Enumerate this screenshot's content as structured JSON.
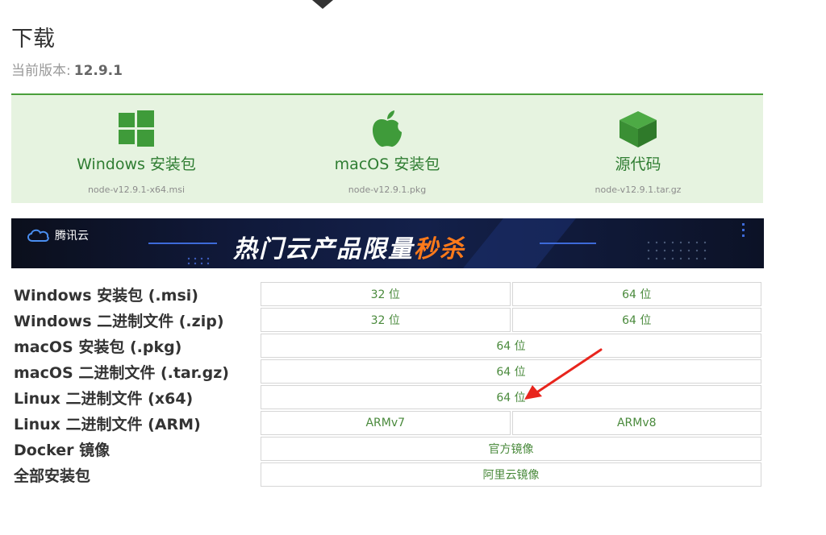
{
  "header": {
    "title": "下载",
    "version_label": "当前版本:",
    "version_value": "12.9.1"
  },
  "downloads": [
    {
      "label": "Windows 安装包",
      "file": "node-v12.9.1-x64.msi",
      "icon": "windows-icon"
    },
    {
      "label": "macOS 安装包",
      "file": "node-v12.9.1.pkg",
      "icon": "apple-icon"
    },
    {
      "label": "源代码",
      "file": "node-v12.9.1.tar.gz",
      "icon": "box-icon"
    }
  ],
  "banner": {
    "brand": "腾讯云",
    "headline_main": "热门云产品限量",
    "headline_highlight": "秒杀"
  },
  "table": {
    "rows": [
      {
        "label": "Windows 安装包 (.msi)",
        "cells": [
          "32 位",
          "64 位"
        ]
      },
      {
        "label": "Windows 二进制文件 (.zip)",
        "cells": [
          "32 位",
          "64 位"
        ]
      },
      {
        "label": "macOS 安装包 (.pkg)",
        "cells": [
          "64 位"
        ]
      },
      {
        "label": "macOS 二进制文件 (.tar.gz)",
        "cells": [
          "64 位"
        ]
      },
      {
        "label": "Linux 二进制文件 (x64)",
        "cells": [
          "64 位"
        ]
      },
      {
        "label": "Linux 二进制文件 (ARM)",
        "cells": [
          "ARMv7",
          "ARMv8"
        ]
      },
      {
        "label": "Docker 镜像",
        "cells": [
          "官方镜像"
        ]
      },
      {
        "label": "全部安装包",
        "cells": [
          "阿里云镜像"
        ]
      }
    ]
  },
  "colors": {
    "accent_green": "#4a9f3b",
    "panel_bg": "#e6f3e0",
    "link_green": "#4a8a3c",
    "annotation_red": "#e8251d",
    "banner_highlight": "#ff7a1a"
  }
}
